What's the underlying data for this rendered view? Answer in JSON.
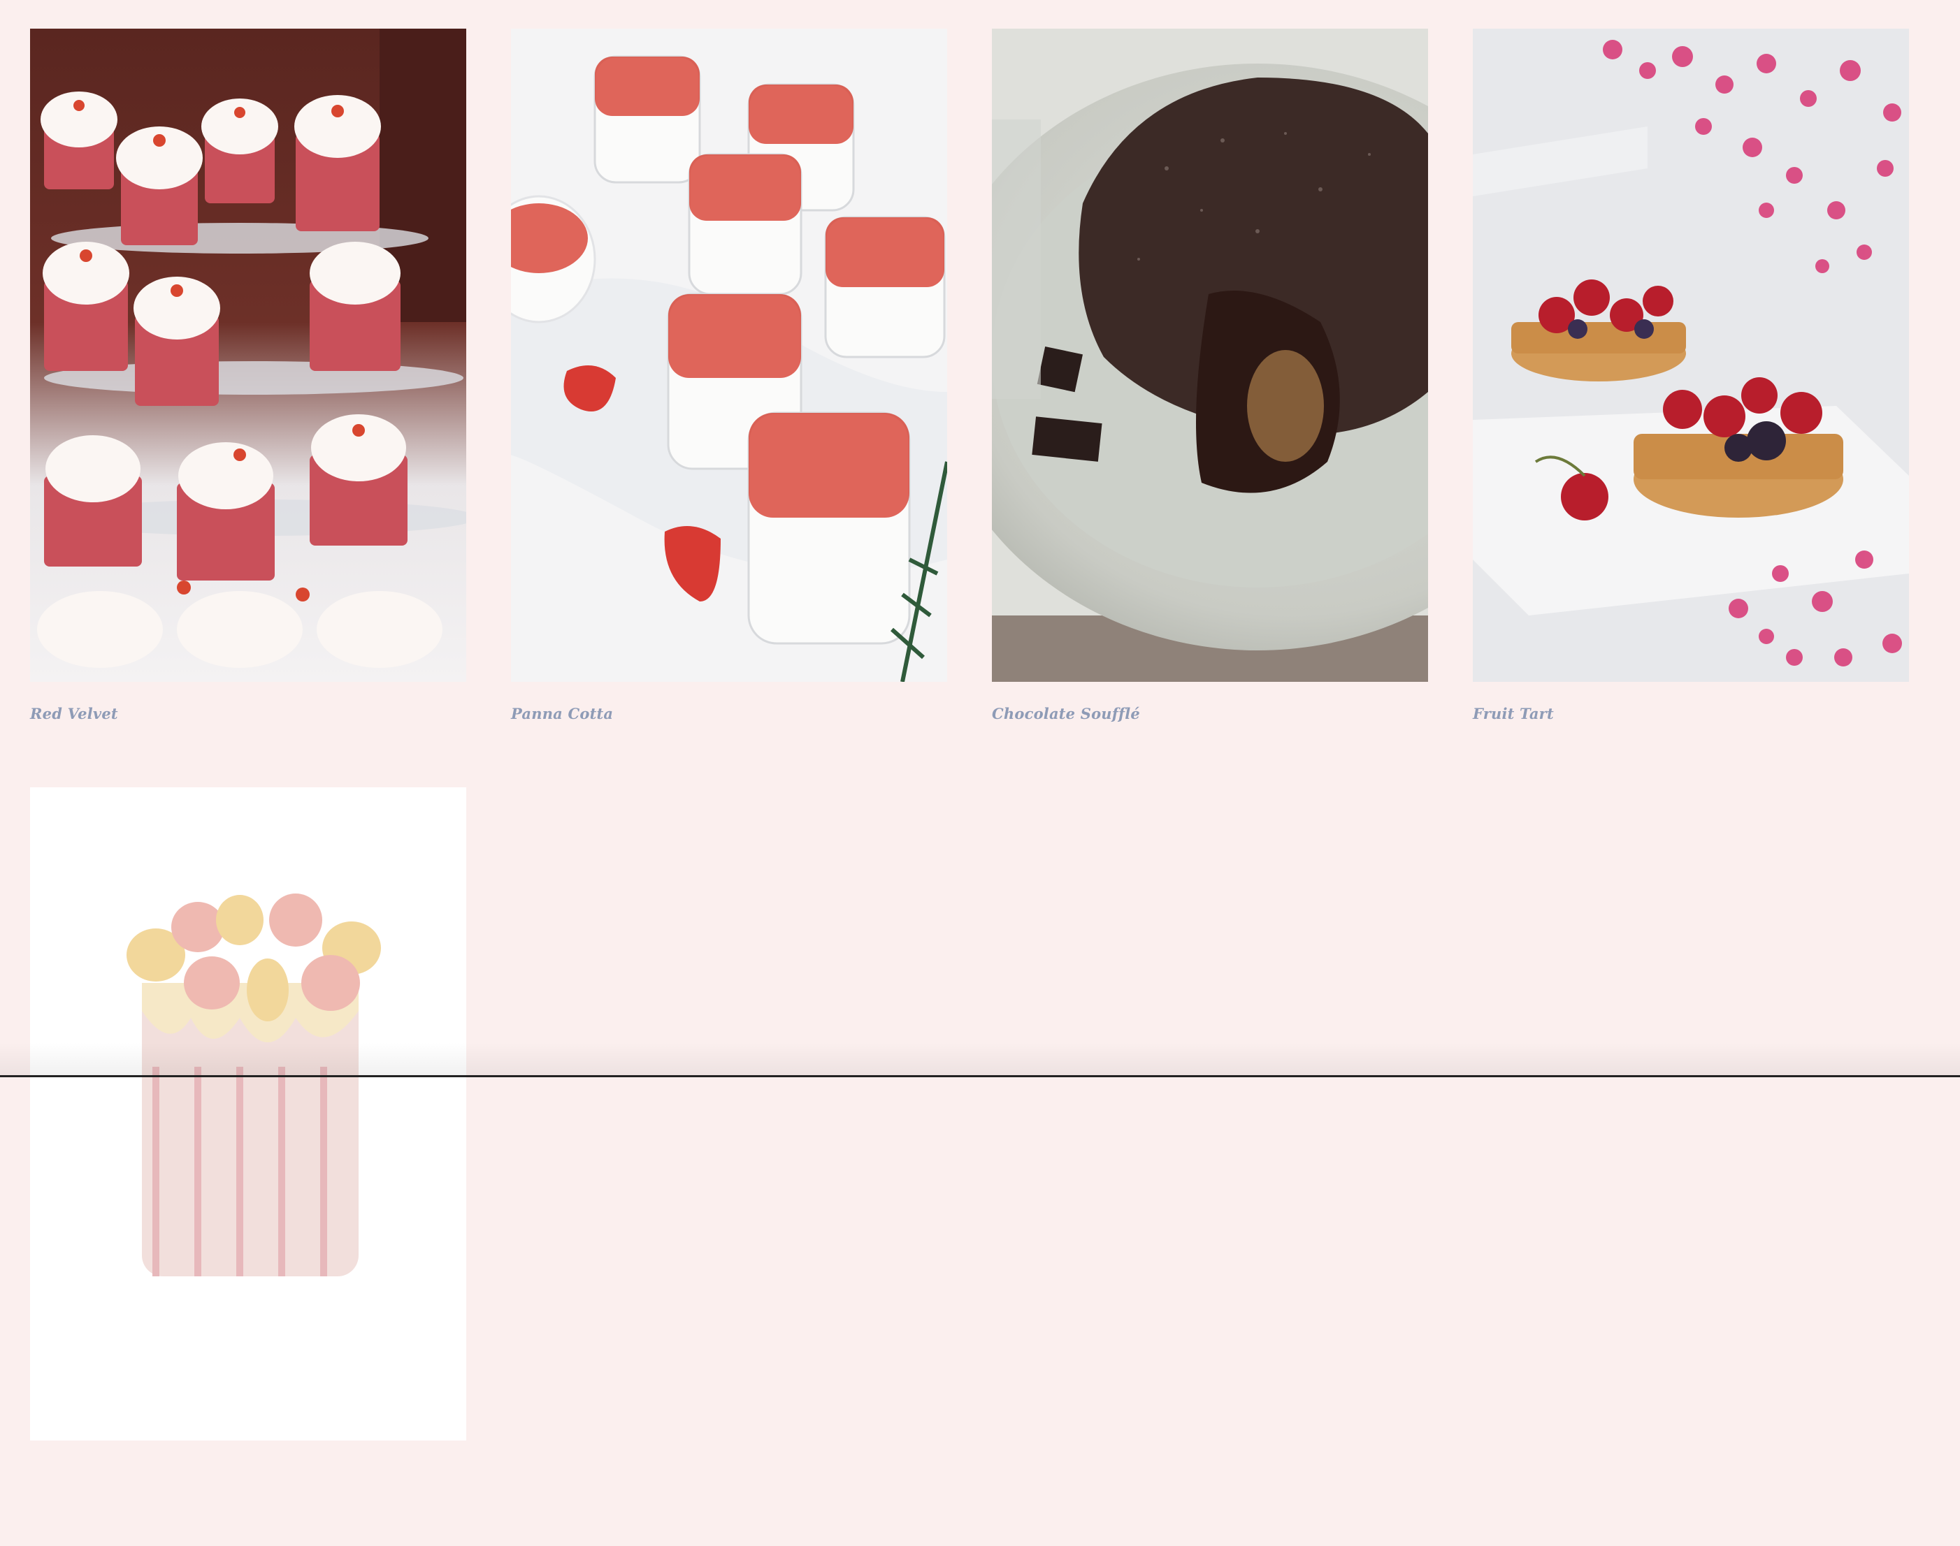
{
  "gallery": {
    "items": [
      {
        "caption": "Red Velvet",
        "image": "red-velvet-cupcakes-photo"
      },
      {
        "caption": "Panna Cotta",
        "image": "panna-cotta-strawberries-photo"
      },
      {
        "caption": "Chocolate Soufflé",
        "image": "chocolate-souffle-photo"
      },
      {
        "caption": "Fruit Tart",
        "image": "fruit-tart-cherries-photo"
      },
      {
        "caption": "",
        "image": "macaron-cake-photo"
      }
    ]
  },
  "colors": {
    "background": "#fbefee",
    "caption_text": "#8e9bb6"
  }
}
